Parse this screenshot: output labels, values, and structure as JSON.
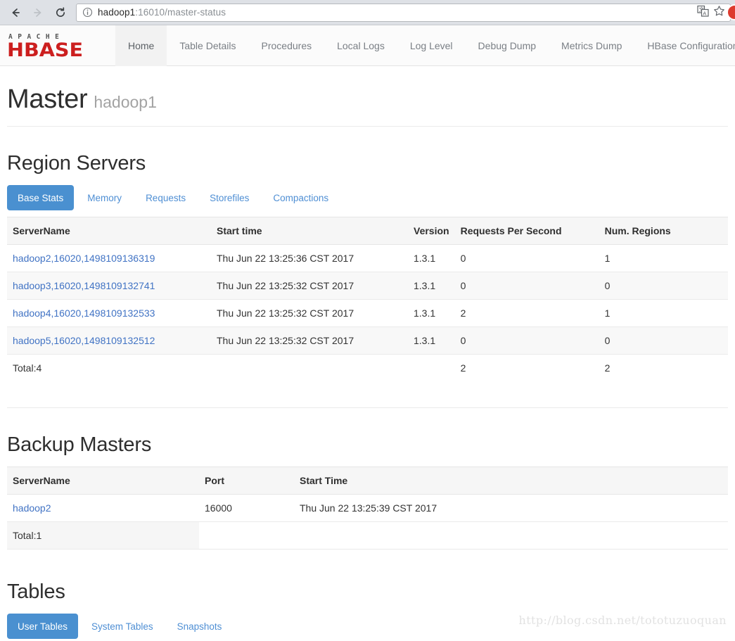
{
  "browser": {
    "url_host": "hadoop1",
    "url_rest": ":16010/master-status",
    "back_icon": "back-arrow-icon",
    "forward_icon": "forward-arrow-icon",
    "reload_icon": "reload-icon",
    "info_icon": "info-circle-icon",
    "translate_icon": "translate-icon",
    "bookmark_icon": "star-icon",
    "profile_icon": "profile-avatar-icon"
  },
  "navbar": {
    "logo_top": "APACHE",
    "logo_main": "HBASE",
    "items": [
      {
        "label": "Home",
        "active": true
      },
      {
        "label": "Table Details",
        "active": false
      },
      {
        "label": "Procedures",
        "active": false
      },
      {
        "label": "Local Logs",
        "active": false
      },
      {
        "label": "Log Level",
        "active": false
      },
      {
        "label": "Debug Dump",
        "active": false
      },
      {
        "label": "Metrics Dump",
        "active": false
      },
      {
        "label": "HBase Configuration",
        "active": false
      }
    ]
  },
  "page_title": {
    "title": "Master",
    "subtitle": "hadoop1"
  },
  "region_servers": {
    "heading": "Region Servers",
    "tabs": [
      {
        "label": "Base Stats",
        "active": true
      },
      {
        "label": "Memory",
        "active": false
      },
      {
        "label": "Requests",
        "active": false
      },
      {
        "label": "Storefiles",
        "active": false
      },
      {
        "label": "Compactions",
        "active": false
      }
    ],
    "columns": [
      "ServerName",
      "Start time",
      "Version",
      "Requests Per Second",
      "Num. Regions"
    ],
    "rows": [
      {
        "server": "hadoop2,16020,1498109136319",
        "start": "Thu Jun 22 13:25:36 CST 2017",
        "version": "1.3.1",
        "rps": "0",
        "regions": "1"
      },
      {
        "server": "hadoop3,16020,1498109132741",
        "start": "Thu Jun 22 13:25:32 CST 2017",
        "version": "1.3.1",
        "rps": "0",
        "regions": "0"
      },
      {
        "server": "hadoop4,16020,1498109132533",
        "start": "Thu Jun 22 13:25:32 CST 2017",
        "version": "1.3.1",
        "rps": "2",
        "regions": "1"
      },
      {
        "server": "hadoop5,16020,1498109132512",
        "start": "Thu Jun 22 13:25:32 CST 2017",
        "version": "1.3.1",
        "rps": "0",
        "regions": "0"
      }
    ],
    "total": {
      "label": "Total:4",
      "start": "",
      "version": "",
      "rps": "2",
      "regions": "2"
    }
  },
  "backup_masters": {
    "heading": "Backup Masters",
    "columns": [
      "ServerName",
      "Port",
      "Start Time"
    ],
    "rows": [
      {
        "server": "hadoop2",
        "port": "16000",
        "start": "Thu Jun 22 13:25:39 CST 2017"
      }
    ],
    "total": {
      "label": "Total:1"
    }
  },
  "tables_section": {
    "heading": "Tables",
    "tabs": [
      {
        "label": "User Tables",
        "active": true
      },
      {
        "label": "System Tables",
        "active": false
      },
      {
        "label": "Snapshots",
        "active": false
      }
    ]
  },
  "watermark": "http://blog.csdn.net/tototuzuoquan",
  "colors": {
    "accent_blue": "#4a90d0",
    "link_blue": "#4173c4",
    "logo_red": "#cc1f1f",
    "header_bg": "#f6f6f6"
  }
}
